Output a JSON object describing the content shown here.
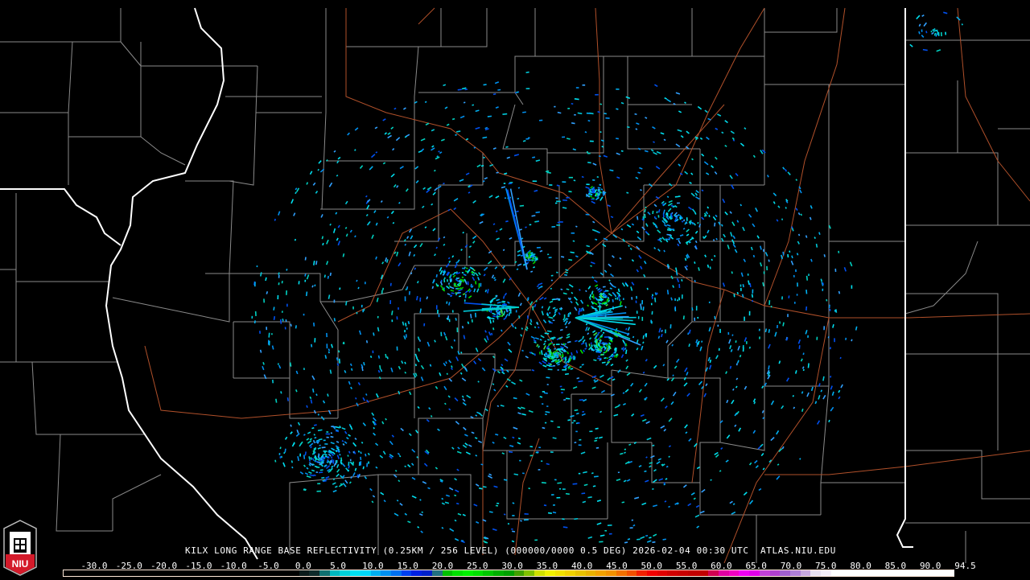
{
  "title": "KILX LONG RANGE BASE REFLECTIVITY (0.25KM / 256 LEVEL) (000000/0000 0.5 DEG) 2026-02-04 00:30 UTC  ATLAS.NIU.EDU",
  "logo": {
    "text": "NIU",
    "icon": "niu-altgeld-tower-logo"
  },
  "colorbar": {
    "labels": [
      "-30.0",
      "-25.0",
      "-20.0",
      "-15.0",
      "-10.0",
      "-5.0",
      "0.0",
      "5.0",
      "10.0",
      "15.0",
      "20.0",
      "25.0",
      "30.0",
      "35.0",
      "40.0",
      "45.0",
      "50.0",
      "55.0",
      "60.0",
      "65.0",
      "70.0",
      "75.0",
      "80.0",
      "85.0",
      "90.0",
      "94.5"
    ],
    "colors": [
      "#000000",
      "#000000",
      "#000000",
      "#000000",
      "#000000",
      "#000000",
      "#000000",
      "#000000",
      "#000000",
      "#000000",
      "#000000",
      "#000000",
      "#000000",
      "#000000",
      "#000000",
      "#000000",
      "#000000",
      "#000000",
      "#000000",
      "#000000",
      "#000000",
      "#000000",
      "#000000",
      "#0a1a1a",
      "#0f2a2a",
      "#0f7070",
      "#00b8c0",
      "#00d0d8",
      "#00e0f0",
      "#00d8f8",
      "#00b0f0",
      "#0090f0",
      "#0070f0",
      "#0040f0",
      "#0020e0",
      "#0020c8",
      "#207080",
      "#00c000",
      "#00e000",
      "#00f000",
      "#00e000",
      "#00c800",
      "#00b000",
      "#00a000",
      "#40a000",
      "#80c000",
      "#d0e000",
      "#f0f000",
      "#f0e000",
      "#f0d000",
      "#e8c000",
      "#e8b000",
      "#f0a000",
      "#f09000",
      "#f07000",
      "#f05000",
      "#f02000",
      "#f00000",
      "#e00000",
      "#d00000",
      "#c80000",
      "#c00000",
      "#c00000",
      "#d00050",
      "#e000a0",
      "#f000c0",
      "#f000f0",
      "#e000e8",
      "#c040d8",
      "#b040d0",
      "#a060d0",
      "#b080d8",
      "#c8a8e0",
      "#e8e0f0",
      "#f4eef8",
      "#ffffff",
      "#ffffff",
      "#ffffff",
      "#ffffff",
      "#ffffff",
      "#ffffff",
      "#ffffff",
      "#ffffff",
      "#ffffff",
      "#ffffff",
      "#ffffff",
      "#ffffff"
    ]
  },
  "map": {
    "county_color": "#8a8a8a",
    "state_color": "#ffffff",
    "road_color": "#b0502a",
    "echo_colors": [
      "#00c8d8",
      "#00e0f0",
      "#00b0f0",
      "#0090f0",
      "#30a0ff",
      "#0050f0",
      "#00d0c0"
    ],
    "core_colors": [
      "#00e000",
      "#00c000",
      "#40e040",
      "#0040f0",
      "#00e0f0"
    ]
  }
}
